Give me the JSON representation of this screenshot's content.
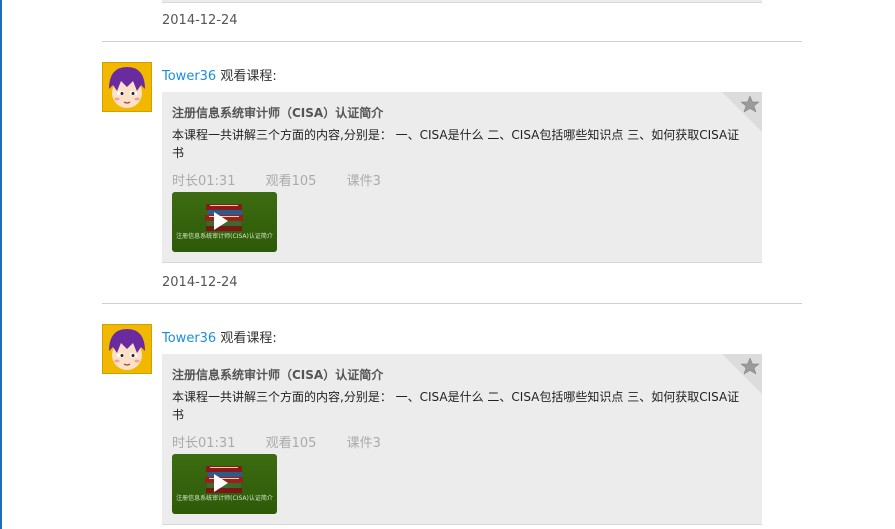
{
  "feed": {
    "items": [
      {
        "date": "2014-12-24",
        "user": "Tower36",
        "action": "观看课程:",
        "course": {
          "title": "注册信息系统审计师（CISA）认证简介",
          "description_line1": "本课程一共讲解三个方面的内容,分别是： 一、CISA是什么 二、CISA包括哪些知识点 三、如何获取CISA证",
          "description_line2": "书",
          "duration": "时长01:31",
          "views": "观看105",
          "coursewares": "课件3",
          "thumb_caption": "注册信息系统审计师(CISA)认证简介"
        }
      },
      {
        "date": "2014-12-24",
        "user": "Tower36",
        "action": "观看课程:",
        "course": {
          "title": "注册信息系统审计师（CISA）认证简介",
          "description_line1": "本课程一共讲解三个方面的内容,分别是： 一、CISA是什么 二、CISA包括哪些知识点 三、如何获取CISA证",
          "description_line2": "书",
          "duration": "时长01:31",
          "views": "观看105",
          "coursewares": "课件3",
          "thumb_caption": "注册信息系统审计师(CISA)认证简介"
        }
      }
    ]
  },
  "icons": {
    "corner": "star-corner-icon",
    "play": "play-icon",
    "avatar": "cartoon-avatar"
  },
  "colors": {
    "username": "#1a8fd8",
    "card_bg": "#ececec",
    "thumb_bg": "#3c6c12"
  }
}
